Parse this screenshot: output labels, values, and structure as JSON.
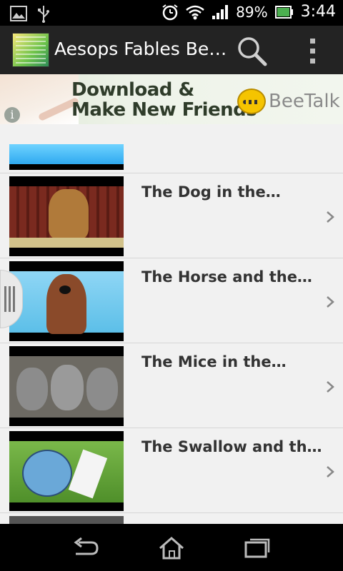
{
  "status_bar": {
    "battery_percent": "89%",
    "time": "3:44",
    "icons": [
      "image-icon",
      "usb-icon",
      "alarm-icon",
      "wifi-icon",
      "signal-icon",
      "battery-icon"
    ]
  },
  "action_bar": {
    "title": "Aesops Fables Be…",
    "icons": [
      "app-icon",
      "search-icon",
      "overflow-menu-icon"
    ]
  },
  "ad": {
    "headline_line1": "Download &",
    "headline_line2": "Make New Friends",
    "brand": "BeeTalk",
    "info_glyph": "i"
  },
  "videos": [
    {
      "title": "The Dog in the…"
    },
    {
      "title": "The Horse and the…"
    },
    {
      "title": "The Mice in the…"
    },
    {
      "title": "The Swallow and th…"
    }
  ],
  "nav_bar": {
    "icons": [
      "back-icon",
      "home-icon",
      "recent-apps-icon"
    ]
  },
  "colors": {
    "action_bar": "#232323",
    "list_bg": "#f1f1f1",
    "title_text": "#333333",
    "battery_green": "#4caf50"
  }
}
